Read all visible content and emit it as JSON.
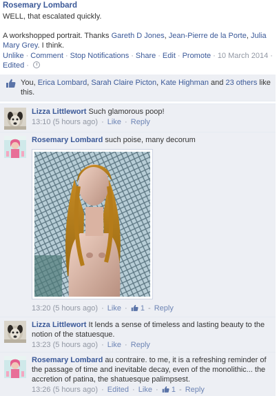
{
  "post": {
    "author": "Rosemary Lombard",
    "line1": "WELL, that escalated quickly.",
    "line2_prefix": "A workshopped portrait. Thanks ",
    "tag1": "Gareth D Jones",
    "tag_sep1": ", ",
    "tag2": "Jean-Pierre de la Porte",
    "tag_sep2": ", ",
    "tag3": "Julia Mary Grey",
    "line2_suffix": ". I think.",
    "actions": {
      "unlike": "Unlike",
      "comment": "Comment",
      "stop_notifications": "Stop Notifications",
      "share": "Share",
      "edit": "Edit",
      "promote": "Promote",
      "date": "10 March 2014",
      "edited": "Edited"
    }
  },
  "likes": {
    "you": "You",
    "sep1": ", ",
    "person1": "Erica Lombard",
    "sep2": ", ",
    "person2": "Sarah Claire Picton",
    "sep3": ", ",
    "person3": "Kate Highman",
    "and": " and ",
    "others": "23 others",
    "suffix": " like this."
  },
  "comments": [
    {
      "author": "Lizza Littlewort",
      "text": "Such glamorous poop!",
      "time": "13:10 (5 hours ago)",
      "like": "Like",
      "reply": "Reply"
    },
    {
      "author": "Rosemary Lombard",
      "text": "such poise, many decorum",
      "time": "13:20 (5 hours ago)",
      "like": "Like",
      "like_count": "1",
      "reply": "Reply"
    },
    {
      "author": "Lizza Littlewort",
      "text": "It lends a sense of timeless and lasting beauty to the notion of the statuesque.",
      "time": "13:23 (5 hours ago)",
      "like": "Like",
      "reply": "Reply"
    },
    {
      "author": "Rosemary Lombard",
      "text": "au contraire. to me, it is a refreshing reminder of the passage of time and inevitable decay, even of the monolithic... the accretion of patina, the shatuesque palimpsest.",
      "time": "13:26 (5 hours ago)",
      "edited": "Edited",
      "like": "Like",
      "like_count": "1",
      "reply": "Reply"
    }
  ],
  "colors": {
    "link": "#3b5998",
    "ufi_background": "#edeff4",
    "muted": "#9197a3"
  }
}
